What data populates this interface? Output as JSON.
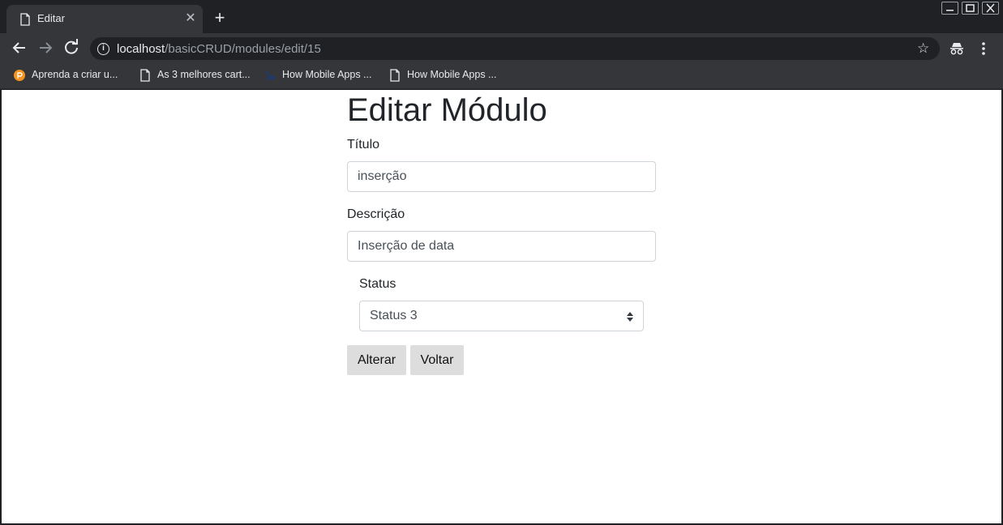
{
  "browser": {
    "tab": {
      "title": "Editar"
    },
    "address_bar": {
      "host": "localhost",
      "path": "/basicCRUD/modules/edit/15"
    },
    "bookmarks": [
      {
        "label": "Aprenda a criar u...",
        "icon": "orange-site-icon"
      },
      {
        "label": "As 3 melhores cart...",
        "icon": "page-icon"
      },
      {
        "label": "How Mobile Apps ...",
        "icon": "blue-site-icon"
      },
      {
        "label": "How Mobile Apps ...",
        "icon": "page-icon"
      }
    ]
  },
  "page": {
    "title": "Editar Módulo",
    "form": {
      "titulo": {
        "label": "Título",
        "value": "inserção"
      },
      "descricao": {
        "label": "Descrição",
        "value": "Inserção de data"
      },
      "status": {
        "label": "Status",
        "selected": "Status 3"
      },
      "buttons": {
        "submit": "Alterar",
        "back": "Voltar"
      }
    }
  }
}
